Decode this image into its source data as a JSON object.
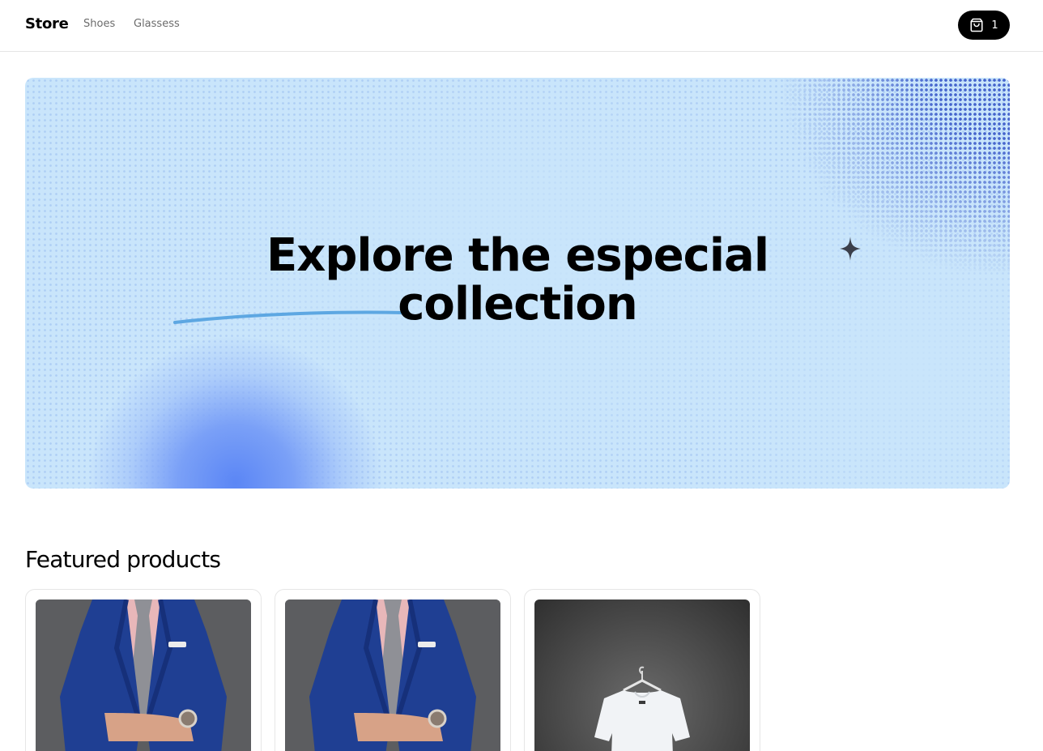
{
  "header": {
    "logo": "Store",
    "nav": [
      "Shoes",
      "Glassess"
    ],
    "cart_count": "1"
  },
  "hero": {
    "title_line1": "Explore the especial",
    "title_line2": "collection"
  },
  "featured": {
    "title": "Featured products",
    "products": [
      {
        "image": "blue-suit-photo"
      },
      {
        "image": "blue-suit-photo"
      },
      {
        "image": "white-tshirt-on-hanger-photo"
      }
    ]
  },
  "colors": {
    "hero_bg": "#c9e5fb",
    "hero_accent": "#4463cc",
    "cart_bg": "#000000",
    "nav_text": "#6b6b6b"
  },
  "icons": [
    "shopping-bag-icon",
    "sparkle-icon"
  ]
}
